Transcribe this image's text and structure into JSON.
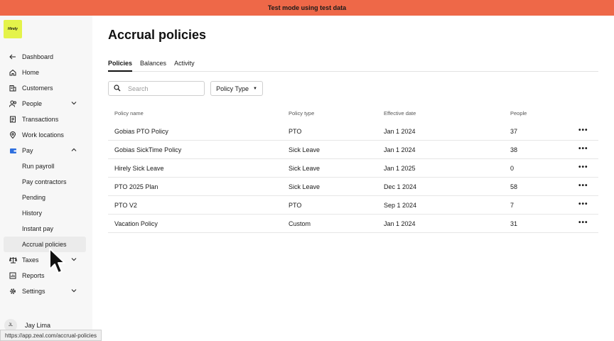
{
  "banner": {
    "text": "Test mode using test data"
  },
  "logo": {
    "text": "Hirely"
  },
  "sidebar": {
    "items": [
      {
        "label": "Dashboard",
        "icon": "arrow-left-icon"
      },
      {
        "label": "Home",
        "icon": "home-icon"
      },
      {
        "label": "Customers",
        "icon": "building-icon"
      },
      {
        "label": "People",
        "icon": "people-icon",
        "chevron": "down"
      },
      {
        "label": "Transactions",
        "icon": "receipt-icon"
      },
      {
        "label": "Work locations",
        "icon": "location-pin-icon"
      },
      {
        "label": "Pay",
        "icon": "wallet-icon",
        "chevron": "up"
      },
      {
        "label": "Run payroll",
        "sub": true
      },
      {
        "label": "Pay contractors",
        "sub": true
      },
      {
        "label": "Pending",
        "sub": true
      },
      {
        "label": "History",
        "sub": true
      },
      {
        "label": "Instant pay",
        "sub": true
      },
      {
        "label": "Accrual policies",
        "sub": true,
        "active": true
      },
      {
        "label": "Taxes",
        "icon": "scale-icon",
        "chevron": "down"
      },
      {
        "label": "Reports",
        "icon": "report-chart-icon"
      },
      {
        "label": "Settings",
        "icon": "gear-icon",
        "chevron": "down"
      }
    ],
    "user": {
      "initials": "JL",
      "name": "Jay Lima"
    }
  },
  "statusbar": {
    "url": "https://app.zeal.com/accrual-policies"
  },
  "main": {
    "title": "Accrual policies",
    "tabs": [
      {
        "label": "Policies",
        "active": true
      },
      {
        "label": "Balances"
      },
      {
        "label": "Activity"
      }
    ],
    "search": {
      "placeholder": "Search",
      "value": ""
    },
    "filter": {
      "label": "Policy Type"
    },
    "table": {
      "headers": [
        "Policy name",
        "Policy type",
        "Effective date",
        "People"
      ],
      "rows": [
        {
          "name": "Gobias PTO Policy",
          "type": "PTO",
          "date": "Jan 1 2024",
          "people": "37"
        },
        {
          "name": "Gobias SickTime Policy",
          "type": "Sick Leave",
          "date": "Jan 1 2024",
          "people": "38"
        },
        {
          "name": "Hirely Sick Leave",
          "type": "Sick Leave",
          "date": "Jan 1 2025",
          "people": "0"
        },
        {
          "name": "PTO 2025 Plan",
          "type": "Sick Leave",
          "date": "Dec 1 2024",
          "people": "58"
        },
        {
          "name": "PTO V2",
          "type": "PTO",
          "date": "Sep 1 2024",
          "people": "7"
        },
        {
          "name": "Vacation Policy",
          "type": "Custom",
          "date": "Jan 1 2024",
          "people": "31"
        }
      ],
      "row_menu": "•••"
    }
  },
  "colors": {
    "banner": "#ee6848",
    "logo_bg": "#e4f34a",
    "active_nav": "#ebebeb"
  }
}
